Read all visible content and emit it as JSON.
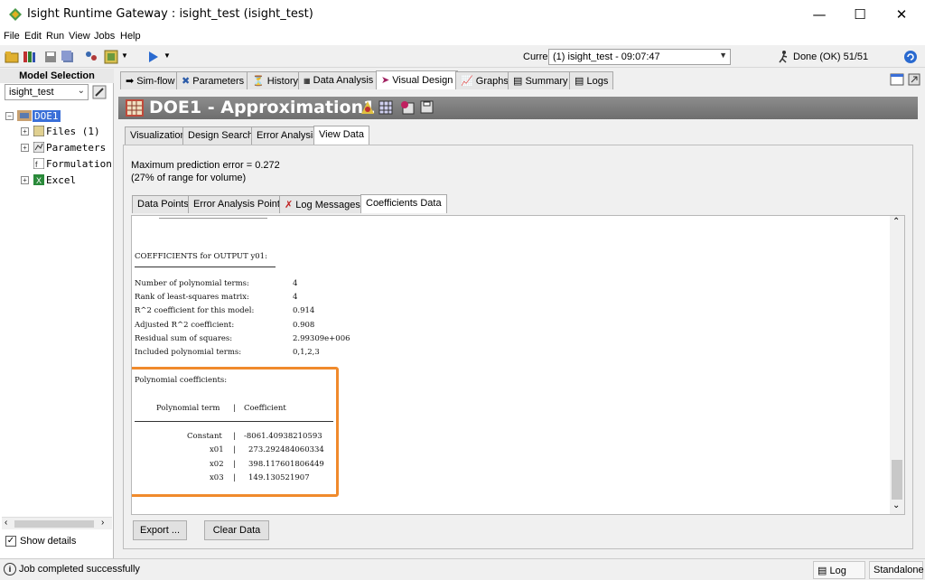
{
  "window": {
    "title": "Isight Runtime Gateway : isight_test (isight_test)"
  },
  "menu": {
    "file": "File",
    "edit": "Edit",
    "run": "Run",
    "view": "View",
    "jobs": "Jobs",
    "help": "Help"
  },
  "toolbar": {
    "current_job_label": "Current Job",
    "current_job_value": "(1) isight_test - 09:07:47",
    "status": "Done (OK) 51/51"
  },
  "left": {
    "title": "Model Selection",
    "model_value": "isight_test",
    "tree": {
      "root": "DOE1",
      "files": "Files (1)",
      "parameters": "Parameters",
      "formulation": "Formulation",
      "excel": "Excel"
    },
    "show_details": "Show details"
  },
  "main_tabs": [
    "Sim-flow",
    "Parameters",
    "History",
    "Data Analysis",
    "Visual Design",
    "Graphs",
    "Summary",
    "Logs"
  ],
  "banner": {
    "title": "DOE1 - Approximation1"
  },
  "sub_tabs": [
    "Visualization",
    "Design Search",
    "Error Analysis",
    "View Data"
  ],
  "prediction": {
    "line1": "Maximum prediction error = 0.272",
    "line2": "(27% of range for volume)"
  },
  "data_tabs": [
    "Data Points",
    "Error Analysis Points",
    "Log Messages",
    "Coefficients Data"
  ],
  "coeff": {
    "header": "COEFFICIENTS for OUTPUT y01:",
    "stats": [
      {
        "label": "Number of polynomial terms:",
        "value": "4"
      },
      {
        "label": "Rank of least-squares matrix:",
        "value": "4"
      },
      {
        "label": "R^2 coefficient for this model:",
        "value": "0.914"
      },
      {
        "label": "Adjusted R^2 coefficient:",
        "value": "0.908"
      },
      {
        "label": "Residual sum of squares:",
        "value": "2.99309e+006"
      },
      {
        "label": "Included polynomial terms:",
        "value": "0,1,2,3"
      }
    ],
    "poly_header": "Polynomial coefficients:",
    "col_term": "Polynomial term",
    "col_coef": "Coefficient",
    "rows": [
      {
        "term": "Constant",
        "coef": "-8061.40938210593"
      },
      {
        "term": "x01",
        "coef": "273.292484060334"
      },
      {
        "term": "x02",
        "coef": "398.117601806449"
      },
      {
        "term": "x03",
        "coef": "149.130521907"
      }
    ]
  },
  "buttons": {
    "export": "Export ...",
    "clear": "Clear Data"
  },
  "status": {
    "message": "Job completed successfully",
    "log": "Log",
    "mode": "Standalone"
  },
  "colors": {
    "highlight_box": "#f08a2c",
    "selection": "#3a6fd8"
  }
}
